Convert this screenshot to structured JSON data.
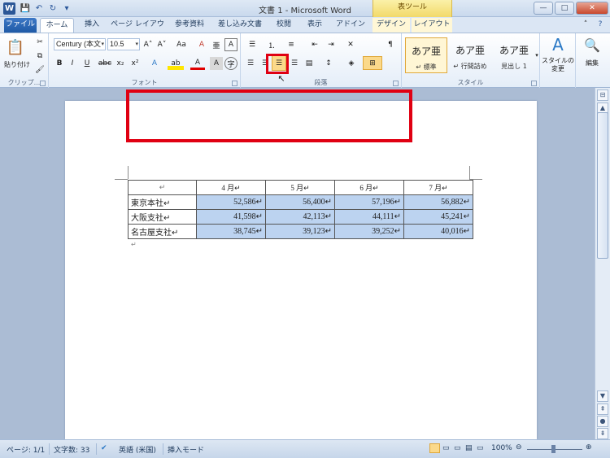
{
  "window": {
    "title": "文書 1 - Microsoft Word",
    "app_icon": "W",
    "table_tools": "表ツール"
  },
  "qat": {
    "save": "💾",
    "undo": "↶",
    "redo": "↻",
    "more": "▾"
  },
  "winctl": {
    "minimize": "—",
    "maximize": "□",
    "close": "✕"
  },
  "tabs": [
    {
      "label": "ファイル"
    },
    {
      "label": "ホーム"
    },
    {
      "label": "挿入"
    },
    {
      "label": "ページ レイアウト"
    },
    {
      "label": "参考資料"
    },
    {
      "label": "差し込み文書"
    },
    {
      "label": "校閲"
    },
    {
      "label": "表示"
    },
    {
      "label": "アドイン"
    },
    {
      "label": "デザイン"
    },
    {
      "label": "レイアウト"
    }
  ],
  "ribbon": {
    "clipboard": {
      "paste": "貼り付け",
      "label": "クリップ..."
    },
    "font": {
      "name": "Century (本文",
      "size": "10.5",
      "label": "フォント",
      "bold": "B",
      "italic": "I",
      "underline": "U",
      "strike": "abc",
      "sub": "x₂",
      "sup": "x²",
      "grow": "A˄",
      "shrink": "A˅",
      "aa": "Aa",
      "clear": "A",
      "highlight": "ab",
      "color": "A",
      "effect": "A"
    },
    "paragraph": {
      "label": "段落"
    },
    "styles": {
      "label": "スタイル",
      "change": "スタイルの変更",
      "tiles": [
        {
          "sample": "あア亜",
          "name": "↵ 標準"
        },
        {
          "sample": "あア亜",
          "name": "↵ 行間詰め"
        },
        {
          "sample": "あア亜",
          "name": "見出し 1"
        }
      ]
    },
    "edit": {
      "label": "編集"
    }
  },
  "table": {
    "corner": "↵",
    "headers": [
      "4 月↵",
      "5 月↵",
      "6 月↵",
      "7 月↵"
    ],
    "rows": [
      {
        "name": "東京本社↵",
        "values": [
          "52,586↵",
          "56,400↵",
          "57,196↵",
          "56,882↵"
        ]
      },
      {
        "name": "大阪支社↵",
        "values": [
          "41,598↵",
          "42,113↵",
          "44,111↵",
          "45,241↵"
        ]
      },
      {
        "name": "名古屋支社↵",
        "values": [
          "38,745↵",
          "39,123↵",
          "39,252↵",
          "40,016↵"
        ]
      }
    ],
    "after_mark": "↵"
  },
  "status": {
    "page": "ページ: 1/1",
    "words": "文字数: 33",
    "lang": "英語 (米国)",
    "mode": "挿入モード",
    "zoom": "100%",
    "zoom_out": "⊖",
    "zoom_in": "⊕"
  },
  "colors": {
    "highlight": "#e00012",
    "selection": "#bcd3f0"
  }
}
